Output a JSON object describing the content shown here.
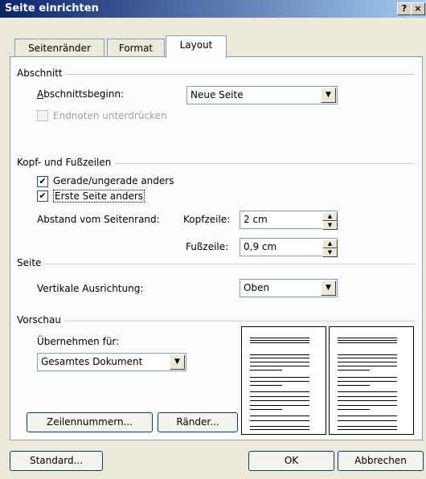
{
  "window": {
    "title": "Seite einrichten",
    "help_button": "?",
    "close_button": "×"
  },
  "tabs": [
    {
      "label": "Seitenränder",
      "active": false
    },
    {
      "label": "Format",
      "active": false
    },
    {
      "label": "Layout",
      "active": true
    }
  ],
  "abschnitt": {
    "group_label": "Abschnitt",
    "beginn_label": "Abschnittsbeginn:",
    "beginn_value": "Neue Seite",
    "endnoten_label": "Endnoten unterdrücken",
    "endnoten_checked": false,
    "endnoten_enabled": false
  },
  "kopf_fuss": {
    "group_label": "Kopf- und Fußzeilen",
    "gerade_label": "Gerade/ungerade anders",
    "gerade_checked": true,
    "erste_label": "Erste Seite anders",
    "erste_checked": true,
    "abstand_label": "Abstand vom Seitenrand:",
    "kopfzeile_label": "Kopfzeile:",
    "kopfzeile_value": "2 cm",
    "fusszeile_label": "Fußzeile:",
    "fusszeile_value": "0,9 cm"
  },
  "seite": {
    "group_label": "Seite",
    "ausrichtung_label": "Vertikale Ausrichtung:",
    "ausrichtung_value": "Oben"
  },
  "vorschau": {
    "group_label": "Vorschau",
    "uebernehmen_label": "Übernehmen für:",
    "uebernehmen_value": "Gesamtes Dokument"
  },
  "buttons": {
    "zeilennummern": "Zeilennummern...",
    "raender": "Ränder...",
    "standard": "Standard...",
    "ok": "OK",
    "abbrechen": "Abbrechen"
  },
  "checkmark": "✔",
  "arrow_down": "▼",
  "arrow_up": "▲"
}
